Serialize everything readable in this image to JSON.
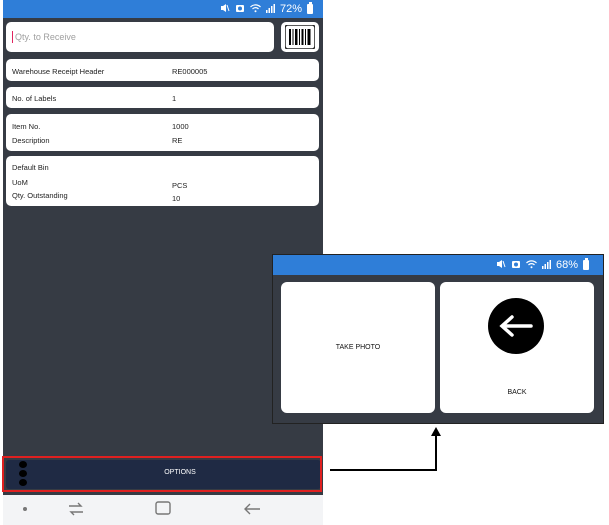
{
  "status_bar": {
    "battery": "72%",
    "icons": [
      "mute-icon",
      "alarm-icon",
      "wifi-icon",
      "signal-icon",
      "battery-icon"
    ]
  },
  "qty_input": {
    "placeholder": "Qty. to Receive",
    "value": ""
  },
  "barcode": {
    "icon": "barcode-icon"
  },
  "cards": {
    "receipt_header": {
      "label": "Warehouse Receipt Header",
      "value": "RE000005"
    },
    "labels": {
      "label": "No. of Labels",
      "value": "1"
    },
    "item": {
      "item_no_label": "Item No.",
      "item_no_value": "1000",
      "description_label": "Description",
      "description_value": "RE"
    },
    "bin": {
      "default_bin_label": "Default Bin",
      "default_bin_value": "",
      "uom_label": "UoM",
      "uom_value": "PCS",
      "outstanding_label": "Qty. Outstanding",
      "outstanding_value": "10"
    }
  },
  "bottom_bar": {
    "options_label": "OPTIONS",
    "menu_icon": "vertical-dots-icon"
  },
  "nav_bar": {
    "icons": [
      "dot-icon",
      "recent-apps-icon",
      "home-icon",
      "back-arrow-icon"
    ]
  },
  "popup": {
    "status_bar": {
      "battery": "68%"
    },
    "take_photo_label": "TAKE PHOTO",
    "back_label": "BACK"
  },
  "colors": {
    "status_bar": "#2f7ed8",
    "background": "#363b44",
    "bottom_bar": "#1f2a44",
    "highlight": "#e02020"
  }
}
